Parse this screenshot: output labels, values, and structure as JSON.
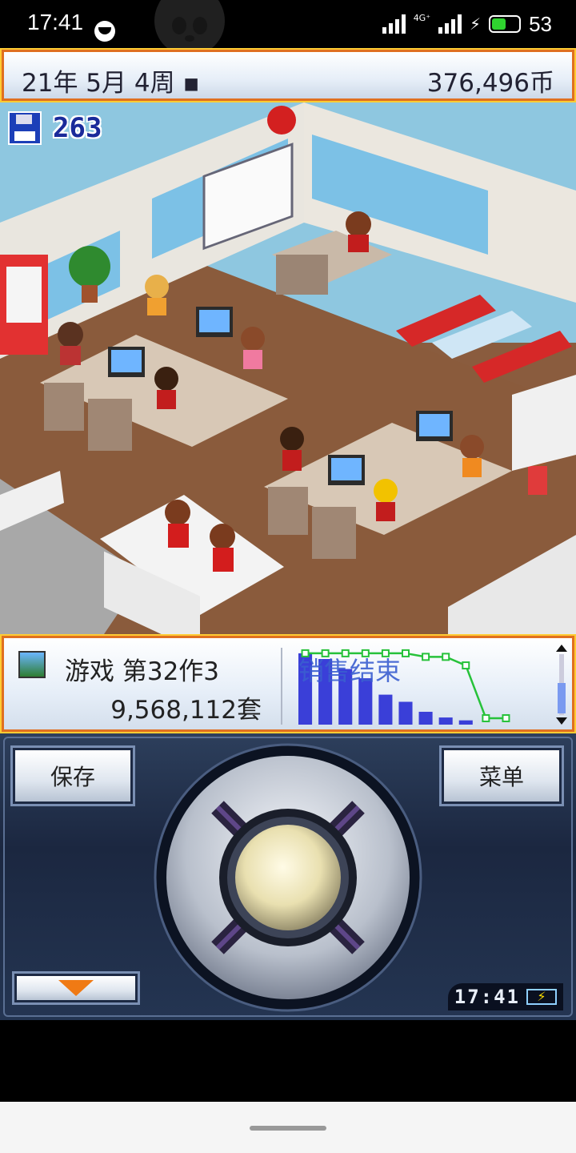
{
  "status_bar": {
    "time": "17:41",
    "network": "4G⁺",
    "battery_percent": "53",
    "battery_level": 0.53,
    "icons": [
      "notification-icon",
      "signal-icon",
      "signal-4g-icon",
      "charging-icon",
      "battery-icon"
    ]
  },
  "header": {
    "date": "21年 5月 4周 ▪",
    "money": "376,496币"
  },
  "scene": {
    "save_count": "263",
    "save_icon": "floppy-disk-icon"
  },
  "info_panel": {
    "game_title": "游戏 第32作3",
    "sales": "9,568,112套",
    "chart_label": "销售结束",
    "chart_data": {
      "type": "bar",
      "title": "",
      "xlabel": "",
      "ylabel": "",
      "categories": [
        "1",
        "2",
        "3",
        "4",
        "5",
        "6",
        "7",
        "8",
        "9",
        "10",
        "11"
      ],
      "series": [
        {
          "values": [
            100,
            92,
            78,
            65,
            42,
            32,
            18,
            10,
            6,
            0,
            0
          ]
        },
        {
          "values": [
            100,
            100,
            100,
            100,
            100,
            100,
            95,
            95,
            83,
            9,
            9
          ]
        }
      ],
      "ylim": [
        0,
        110
      ],
      "grid": false,
      "colors": {
        "bars": "#3a3fd8",
        "line": "#27c23a"
      }
    }
  },
  "controls": {
    "save_label": "保存",
    "menu_label": "菜单",
    "down_icon": "arrow-down-icon",
    "dpad": "directional-pad",
    "clock_time": "17:41",
    "clock_battery_icon": "charging-battery-icon"
  },
  "colors": {
    "frame_orange": "#e07020",
    "frame_gold": "#ffcc33",
    "controller_bg": "#1b2740"
  }
}
